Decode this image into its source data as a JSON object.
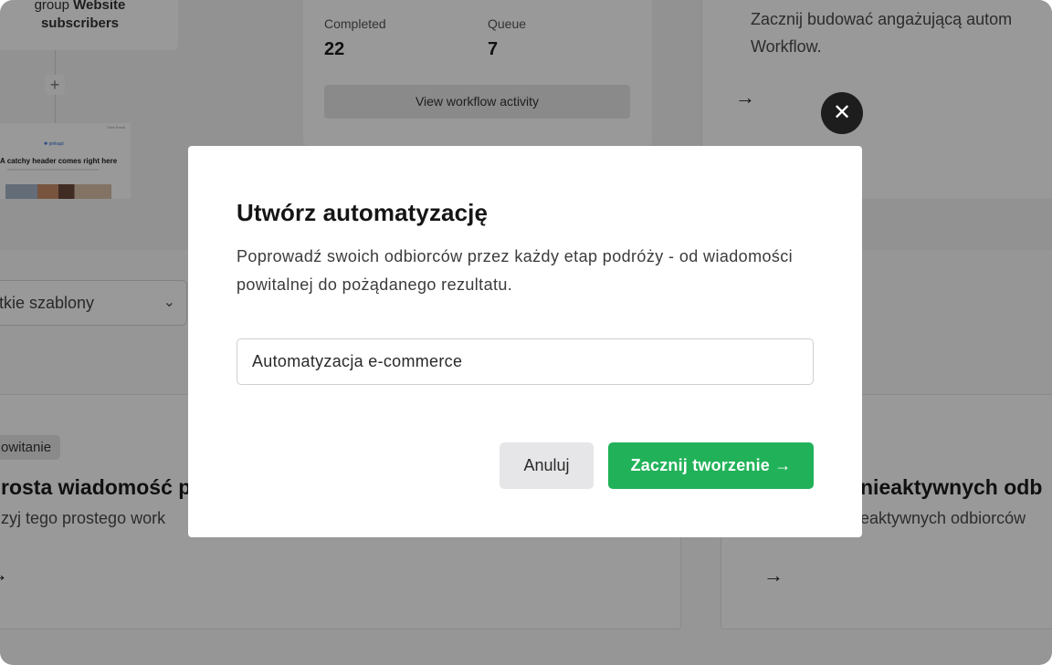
{
  "background": {
    "group_card": {
      "text_prefix": "group",
      "text_bold": "Website",
      "line2": "subscribers"
    },
    "plus_label": "+",
    "email_preview": {
      "top_text": "View Email",
      "logo_text": "✱ pinkapt",
      "headline": "A catchy header comes right here"
    },
    "stats": {
      "completed_label": "Completed",
      "completed_value": "22",
      "queue_label": "Queue",
      "queue_value": "7",
      "activity_button": "View workflow activity"
    },
    "workflow_card": {
      "line1": "Zacznij budować angażującą autom",
      "line2": "Workflow."
    },
    "templates_filter": {
      "label": "stkie szablony"
    },
    "left_template": {
      "tag": "owitanie",
      "title": "rosta wiadomość p",
      "description": "zyj tego prostego work"
    },
    "right_template": {
      "title": "nieaktywnych odb",
      "description": "eaktywnych odbiorców"
    },
    "arrow_glyph": "→",
    "chevron_glyph": "⌄"
  },
  "modal": {
    "close_glyph": "✕",
    "title": "Utwórz automatyzację",
    "description": "Poprowadź swoich odbiorców przez każdy etap podróży - od wiadomości powitalnej do pożądanego rezultatu.",
    "input_value": "Automatyzacja e-commerce",
    "cancel_label": "Anuluj",
    "primary_label": "Zacznij tworzenie →"
  },
  "colors": {
    "primary": "#21b259",
    "backdrop": "rgba(0,0,0,0.40)"
  }
}
